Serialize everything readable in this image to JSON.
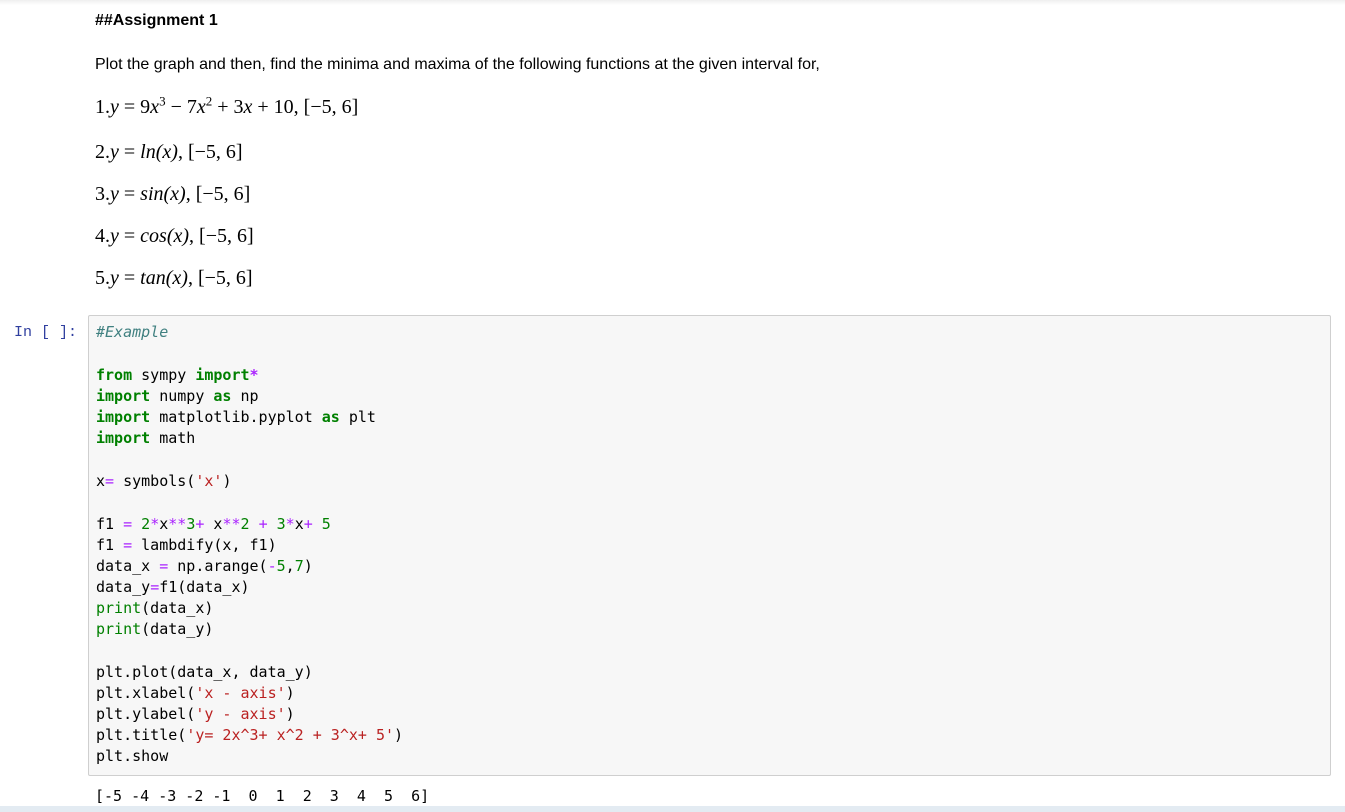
{
  "markdown": {
    "title": "##Assignment 1",
    "intro": "Plot the graph and then, find the minima and maxima of the following functions at the given interval for,",
    "items": [
      {
        "num": "1.",
        "y": "y",
        "eq": " = 9",
        "x1": "x",
        "p1": "3",
        "m1": " − 7",
        "x2": "x",
        "p2": "2",
        "rest1": " + 3",
        "x3": "x",
        "rest2": " + 10, [−5, 6]"
      },
      {
        "num": "2.",
        "y": "y",
        "eq": " = ",
        "fn": "ln",
        "arg": "(x)",
        "interval": ", [−5, 6]"
      },
      {
        "num": "3.",
        "y": "y",
        "eq": " = ",
        "fn": "sin",
        "arg": "(x)",
        "interval": ", [−5, 6]"
      },
      {
        "num": "4.",
        "y": "y",
        "eq": " = ",
        "fn": "cos",
        "arg": "(x)",
        "interval": ", [−5, 6]"
      },
      {
        "num": "5.",
        "y": "y",
        "eq": " = ",
        "fn": "tan",
        "arg": "(x)",
        "interval": ", [−5, 6]"
      }
    ]
  },
  "cell": {
    "prompt": "In [ ]:",
    "code": {
      "comment": "#Example",
      "l_from": "from",
      "l_sympy": " sympy ",
      "l_import": "import",
      "l_star": "*",
      "l_imp2": "import",
      "l_numpy": " numpy ",
      "l_as": "as",
      "l_np": " np",
      "l_imp3": "import",
      "l_mpl": " matplotlib.pyplot ",
      "l_as2": "as",
      "l_plt": " plt",
      "l_imp4": "import",
      "l_math": " math",
      "sym_x": "x",
      "sym_eq": "=",
      "sym_rest": " symbols(",
      "sym_str": "'x'",
      "sym_close": ")",
      "f1_a": "f1 ",
      "f1_eq": "=",
      "f1_sp": " ",
      "f1_2": "2",
      "f1_mul": "*",
      "f1_x1": "x",
      "f1_pow": "**",
      "f1_3": "3",
      "f1_plus": "+",
      "f1_sp2": " x",
      "f1_pow2": "**",
      "f1_2b": "2",
      "f1_sp3": " ",
      "f1_plus2": "+",
      "f1_sp4": " ",
      "f1_3b": "3",
      "f1_mul2": "*",
      "f1_x3": "x",
      "f1_plus3": "+",
      "f1_sp5": " ",
      "f1_5": "5",
      "lam_a": "f1 ",
      "lam_eq": "=",
      "lam_rest": " lambdify(x, f1)",
      "dx_a": "data_x ",
      "dx_eq": "=",
      "dx_rest": " np.arange(",
      "dx_neg": "-",
      "dx_5": "5",
      "dx_comma": ",",
      "dx_7": "7",
      "dx_close": ")",
      "dy_a": "data_y",
      "dy_eq": "=",
      "dy_rest": "f1(data_x)",
      "pr1": "print",
      "pr1_rest": "(data_x)",
      "pr2": "print",
      "pr2_rest": "(data_y)",
      "plot_line": "plt.plot(data_x, data_y)",
      "xl_a": "plt.xlabel(",
      "xl_s": "'x - axis'",
      "xl_c": ")",
      "yl_a": "plt.ylabel(",
      "yl_s": "'y - axis'",
      "yl_c": ")",
      "ti_a": "plt.title(",
      "ti_s": "'y= 2x^3+ x^2 + 3^x+ 5'",
      "ti_c": ")",
      "show": "plt.show"
    },
    "output": "[-5 -4 -3 -2 -1  0  1  2  3  4  5  6]"
  }
}
